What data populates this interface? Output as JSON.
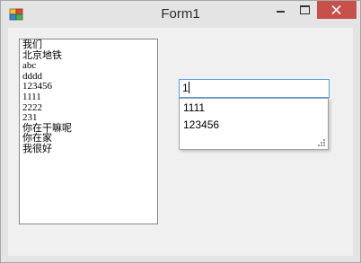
{
  "window": {
    "title": "Form1"
  },
  "listbox": {
    "items": [
      "我们",
      "北京地铁",
      "abc",
      "dddd",
      "123456",
      "1111",
      "2222",
      "231",
      "你在干嘛呢",
      "你在家",
      "我很好"
    ]
  },
  "textbox": {
    "value": "1"
  },
  "autocomplete": {
    "options": [
      "1111",
      "123456"
    ]
  },
  "colors": {
    "close_button": "#c7504b",
    "textbox_border": "#569de5"
  }
}
